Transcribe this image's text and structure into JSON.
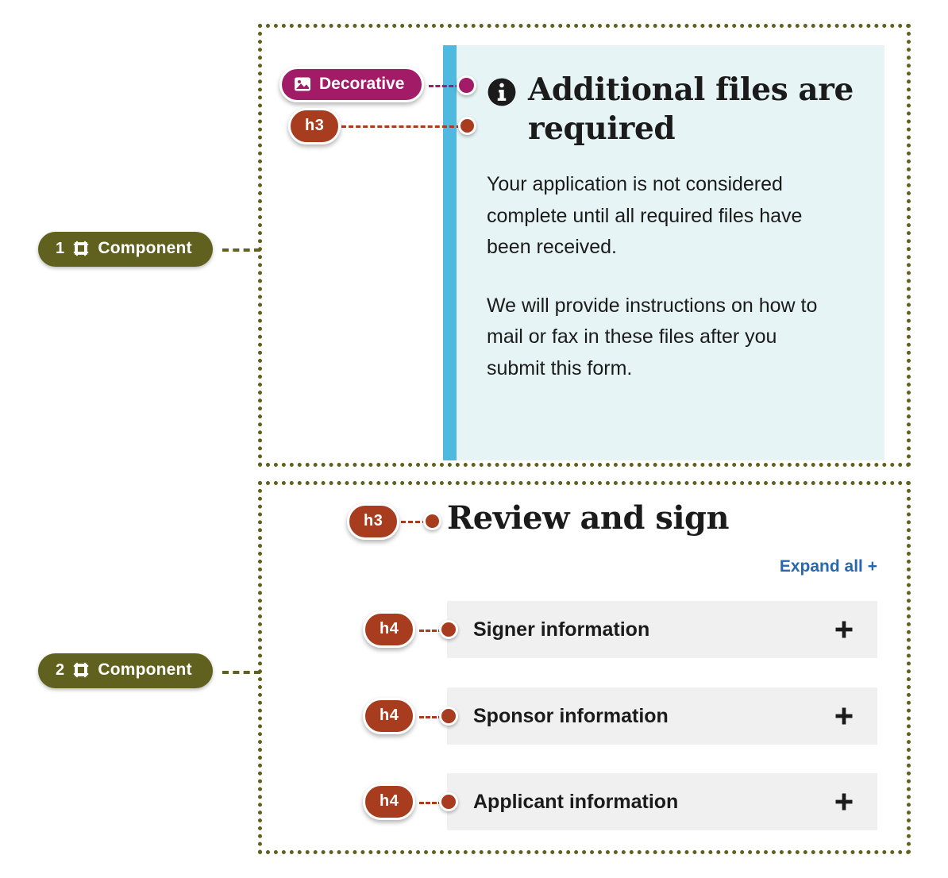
{
  "annotations": {
    "components": [
      {
        "number": "1",
        "label": "Component",
        "icon": "frame-icon",
        "color": "#60601f"
      },
      {
        "number": "2",
        "label": "Component",
        "icon": "frame-icon",
        "color": "#60601f"
      }
    ],
    "tags": [
      {
        "label": "Decorative",
        "icon": "image-icon",
        "color": "#a21b66"
      },
      {
        "label": "h3",
        "color": "#a73c1e"
      },
      {
        "label": "h3",
        "color": "#a73c1e"
      },
      {
        "label": "h4",
        "color": "#a73c1e"
      },
      {
        "label": "h4",
        "color": "#a73c1e"
      },
      {
        "label": "h4",
        "color": "#a73c1e"
      }
    ]
  },
  "alert": {
    "icon": "info-icon",
    "accent_color": "#4fb9e0",
    "background_color": "#e7f4f5",
    "title": "Additional files are required",
    "paragraphs": [
      "Your application is not considered complete until all required files have been received.",
      "We will provide instructions on how to mail or fax in these files after you submit this form."
    ]
  },
  "review_section": {
    "title": "Review and sign",
    "expand_all_label": "Expand all +",
    "expand_all_color": "#2a68ad",
    "accordion_items": [
      {
        "label": "Signer information",
        "icon": "plus-icon",
        "expanded": false
      },
      {
        "label": "Sponsor information",
        "icon": "plus-icon",
        "expanded": false
      },
      {
        "label": "Applicant information",
        "icon": "plus-icon",
        "expanded": false
      }
    ]
  }
}
